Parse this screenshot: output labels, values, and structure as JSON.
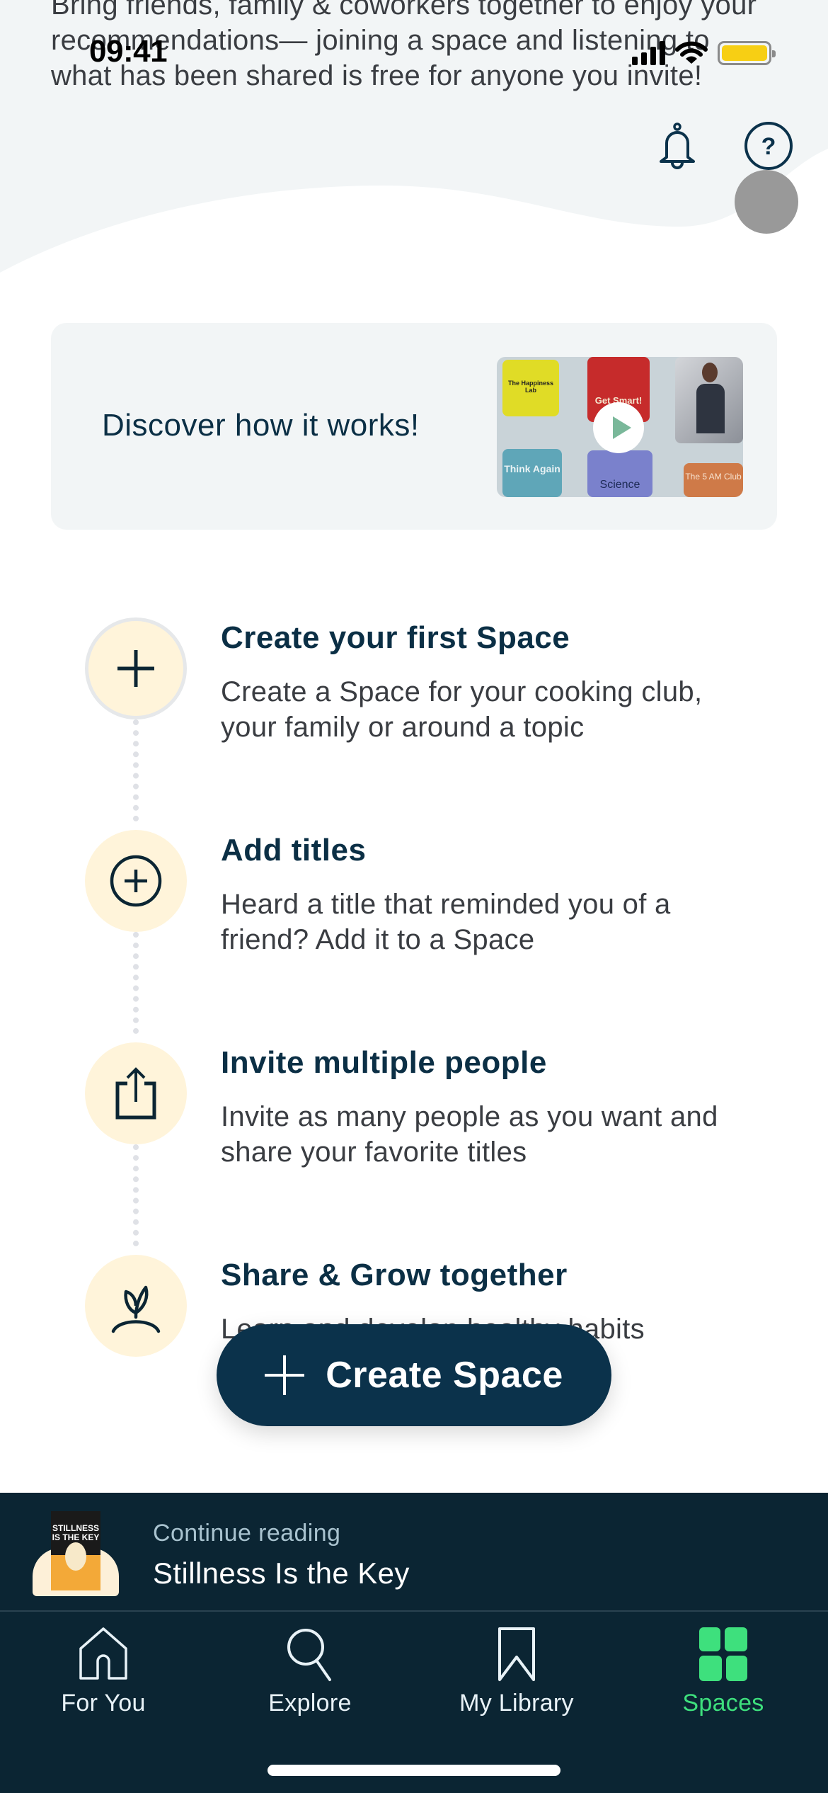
{
  "status_bar": {
    "time": "09:41",
    "icons": [
      "signal-icon",
      "wifi-icon",
      "battery-icon"
    ],
    "battery_color": "#f7cf14"
  },
  "intro": {
    "text": "Bring friends, family & coworkers together to enjoy your recommendations— joining a space and listening to what has been shared is free for anyone you invite!"
  },
  "header_actions": {
    "notifications_icon": "bell-icon",
    "help_icon": "help-circle-icon",
    "help_glyph": "?"
  },
  "discover": {
    "title": "Discover how it works!",
    "video_thumbnail": {
      "tiles": [
        "The Happiness Lab",
        "Get Smart!",
        "Meditation photo",
        "Think Again",
        "Science",
        "The 5 AM Club"
      ],
      "play_icon": "play-icon"
    }
  },
  "steps": [
    {
      "icon": "plus-icon",
      "title": "Create your first Space",
      "description": "Create a Space for your cooking club, your family or around a topic"
    },
    {
      "icon": "plus-circle-icon",
      "title": "Add titles",
      "description": "Heard a title that reminded you of a friend? Add it to a Space"
    },
    {
      "icon": "share-icon",
      "title": "Invite multiple people",
      "description": "Invite as many people as you want and share your favorite titles"
    },
    {
      "icon": "sprout-icon",
      "title": "Share & Grow together",
      "description": "Learn and develop healthy habits"
    }
  ],
  "create_button": {
    "label": "Create Space",
    "icon": "plus-icon"
  },
  "continue_reading": {
    "label": "Continue reading",
    "title": "Stillness Is the Key",
    "cover_text": "STILLNESS IS THE KEY"
  },
  "bottom_nav": {
    "items": [
      {
        "label": "For You",
        "icon": "home-icon",
        "active": false
      },
      {
        "label": "Explore",
        "icon": "search-icon",
        "active": false
      },
      {
        "label": "My Library",
        "icon": "bookmark-icon",
        "active": false
      },
      {
        "label": "Spaces",
        "icon": "spaces-grid-icon",
        "active": true
      }
    ],
    "active_color": "#3ee07d"
  },
  "colors": {
    "primary_navy": "#0b324b",
    "nav_background": "#0b2533",
    "step_circle": "#fff4da"
  }
}
